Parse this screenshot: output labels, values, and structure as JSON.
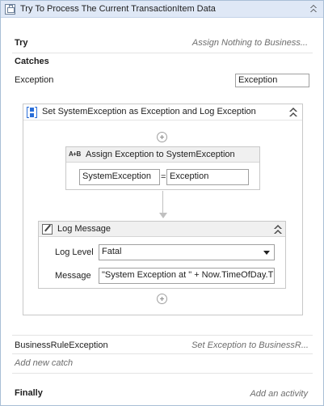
{
  "header": {
    "title": "Try To Process The Current TransactionItem Data",
    "icon": "try-catch-icon"
  },
  "try": {
    "label": "Try",
    "summary": "Assign Nothing to Business..."
  },
  "catches": {
    "label": "Catches",
    "exception_type": "Exception",
    "exception_name": "Exception",
    "sequence": {
      "title": "Set SystemException as Exception and Log Exception",
      "assign": {
        "title": "Assign Exception to SystemException",
        "icon_text": "A+B",
        "to": "SystemException",
        "equals": "=",
        "value": "Exception"
      },
      "log": {
        "title": "Log Message",
        "level_label": "Log Level",
        "level_value": "Fatal",
        "message_label": "Message",
        "message_value": "\"System Exception at \" + Now.TimeOfDay.T"
      }
    },
    "business_rule": {
      "type": "BusinessRuleException",
      "summary": "Set Exception to BusinessR..."
    },
    "add_catch": "Add new catch"
  },
  "finally": {
    "label": "Finally",
    "add_activity": "Add an activity"
  }
}
